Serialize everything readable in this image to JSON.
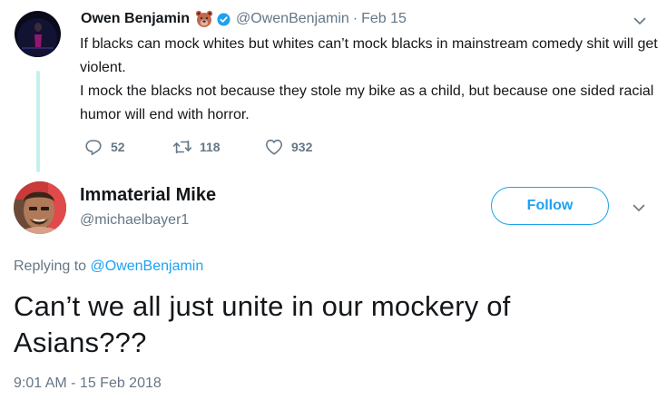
{
  "tweet1": {
    "name": "Owen Benjamin",
    "handle": "@OwenBenjamin",
    "separator": "·",
    "date": "Feb 15",
    "body_line1": "If blacks can mock whites but whites can’t mock blacks in mainstream comedy shit will get violent.",
    "body_line2": "I mock the blacks not because they stole my bike as a child, but because one sided racial humor will end with horror.",
    "reply_count": "52",
    "retweet_count": "118",
    "like_count": "932"
  },
  "tweet2": {
    "name": "Immaterial Mike",
    "handle": "@michaelbayer1",
    "follow_label": "Follow",
    "replying_prefix": "Replying to",
    "replying_to": "@OwenBenjamin",
    "body": "Can’t we all just unite in our mockery of Asians???",
    "timestamp": "9:01 AM - 15 Feb 2018"
  },
  "colors": {
    "accent": "#1da1f2",
    "secondary_text": "#657786",
    "primary_text": "#14171a",
    "thread_line": "#c4f0ee"
  },
  "icons": {
    "reply": "reply-icon",
    "retweet": "retweet-icon",
    "like": "heart-icon",
    "verified": "verified-badge-icon",
    "emoji": "bear-face-emoji",
    "menu": "chevron-down-icon"
  }
}
